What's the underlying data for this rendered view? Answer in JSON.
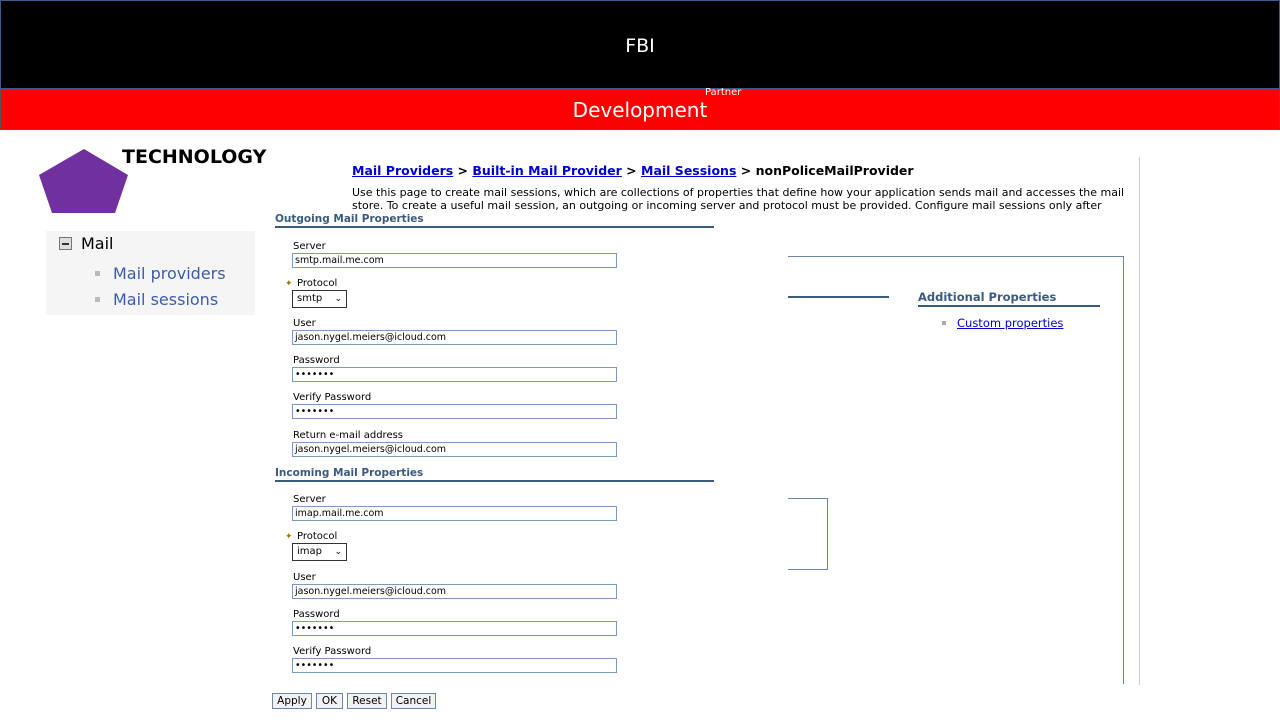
{
  "banner": {
    "title": "FBI",
    "subtitle": "Development",
    "partner": "Partner"
  },
  "brand": {
    "name": "TECHNOLOGY",
    "logo_icon": "pentagon-logo-icon",
    "logo_color": "#7030a0"
  },
  "nav": {
    "group_label": "Mail",
    "items": [
      {
        "label": "Mail providers"
      },
      {
        "label": "Mail sessions"
      }
    ]
  },
  "breadcrumb": {
    "items": [
      "Mail Providers",
      "Built-in Mail Provider",
      "Mail Sessions"
    ],
    "separator": ">",
    "current": "nonPoliceMailProvider"
  },
  "description": "Use this page to create mail sessions, which are collections of properties that define how your application sends mail and accesses the mail store. To create a useful mail session, an outgoing or incoming server and protocol must be provided. Configure mail sessions only after",
  "additional_properties": {
    "heading": "Additional Properties",
    "links": [
      "Custom properties"
    ]
  },
  "outgoing": {
    "heading": "Outgoing Mail Properties",
    "server_label": "Server",
    "server_value": "smtp.mail.me.com",
    "protocol_label": "Protocol",
    "protocol_value": "smtp",
    "user_label": "User",
    "user_value": "jason.nygel.meiers@icloud.com",
    "password_label": "Password",
    "password_value": "•••••••",
    "verify_label": "Verify Password",
    "verify_value": "•••••••",
    "return_label": "Return e-mail address",
    "return_value": "jason.nygel.meiers@icloud.com"
  },
  "incoming": {
    "heading": "Incoming Mail Properties",
    "server_label": "Server",
    "server_value": "imap.mail.me.com",
    "protocol_label": "Protocol",
    "protocol_value": "imap",
    "user_label": "User",
    "user_value": "jason.nygel.meiers@icloud.com",
    "password_label": "Password",
    "password_value": "•••••••",
    "verify_label": "Verify Password",
    "verify_value": "•••••••"
  },
  "required_marker": "✦",
  "buttons": {
    "apply": "Apply",
    "ok": "OK",
    "reset": "Reset",
    "cancel": "Cancel"
  }
}
